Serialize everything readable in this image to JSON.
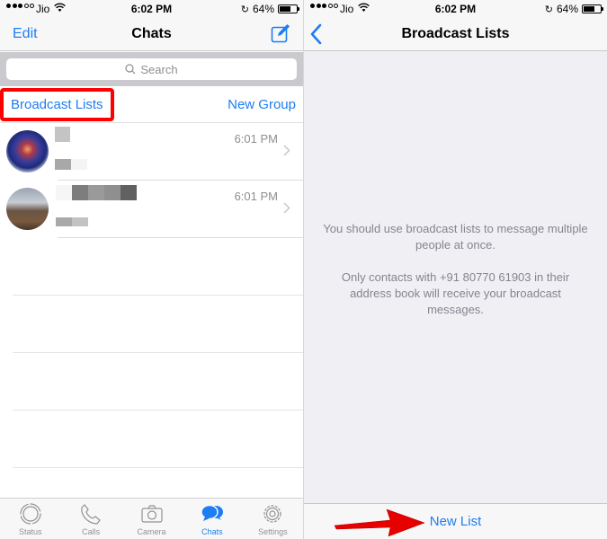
{
  "status_bar": {
    "signal_bars_filled": 3,
    "signal_bars_total": 5,
    "carrier": "Jio",
    "time": "6:02 PM",
    "battery_percent_label": "64%",
    "battery_level": 0.64
  },
  "left_screen": {
    "nav": {
      "edit_label": "Edit",
      "title": "Chats",
      "compose_icon": "compose-icon"
    },
    "search": {
      "placeholder": "Search"
    },
    "actions": {
      "broadcast_label": "Broadcast Lists",
      "new_group_label": "New Group"
    },
    "chats": [
      {
        "name": "[blurred]",
        "preview": "[blurred]",
        "time": "6:01 PM"
      },
      {
        "name": "[blurred]",
        "preview": "[blurred]",
        "time": "6:01 PM"
      }
    ],
    "tabs": [
      {
        "label": "Status",
        "icon": "status-icon",
        "active": false
      },
      {
        "label": "Calls",
        "icon": "phone-icon",
        "active": false
      },
      {
        "label": "Camera",
        "icon": "camera-icon",
        "active": false
      },
      {
        "label": "Chats",
        "icon": "chat-bubbles-icon",
        "active": true
      },
      {
        "label": "Settings",
        "icon": "gear-icon",
        "active": false
      }
    ]
  },
  "right_screen": {
    "nav": {
      "title": "Broadcast Lists",
      "back_icon": "chevron-left-icon"
    },
    "info_paragraph_1": "You should use broadcast lists to message multiple people at once.",
    "info_paragraph_2": "Only contacts with +91 80770 61903 in their address book will receive your broadcast messages.",
    "new_list_label": "New List"
  },
  "colors": {
    "accent": "#1d7df2",
    "highlight_box": "#ff0000",
    "annotation_arrow": "#e60000"
  }
}
